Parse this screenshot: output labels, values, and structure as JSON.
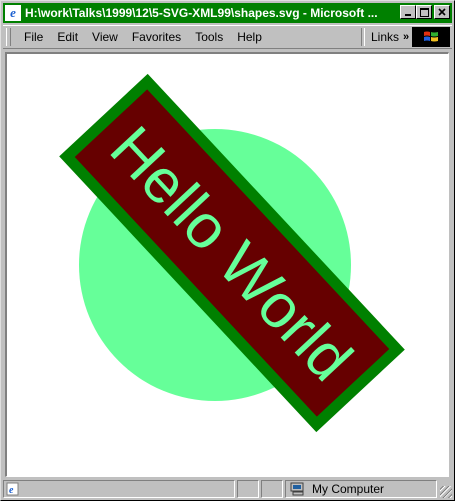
{
  "window": {
    "title": "H:\\work\\Talks\\1999\\12\\5-SVG-XML99\\shapes.svg - Microsoft ...",
    "icon": "ie-page-icon",
    "buttons": [
      "minimize",
      "maximize",
      "close"
    ]
  },
  "menu": {
    "items": [
      {
        "label": "File",
        "mnemonic": "F"
      },
      {
        "label": "Edit",
        "mnemonic": "E"
      },
      {
        "label": "View",
        "mnemonic": "V"
      },
      {
        "label": "Favorites",
        "mnemonic": "a"
      },
      {
        "label": "Tools",
        "mnemonic": "T"
      },
      {
        "label": "Help",
        "mnemonic": "H"
      }
    ],
    "links_label": "Links",
    "chevron": "»"
  },
  "svg_content": {
    "circle_color": "#66ff99",
    "rect_fill": "#660000",
    "rect_stroke": "#008000",
    "text": "Hello World",
    "text_color": "#66ff99"
  },
  "status": {
    "zone_label": "My Computer",
    "zone_icon": "computer-icon"
  }
}
